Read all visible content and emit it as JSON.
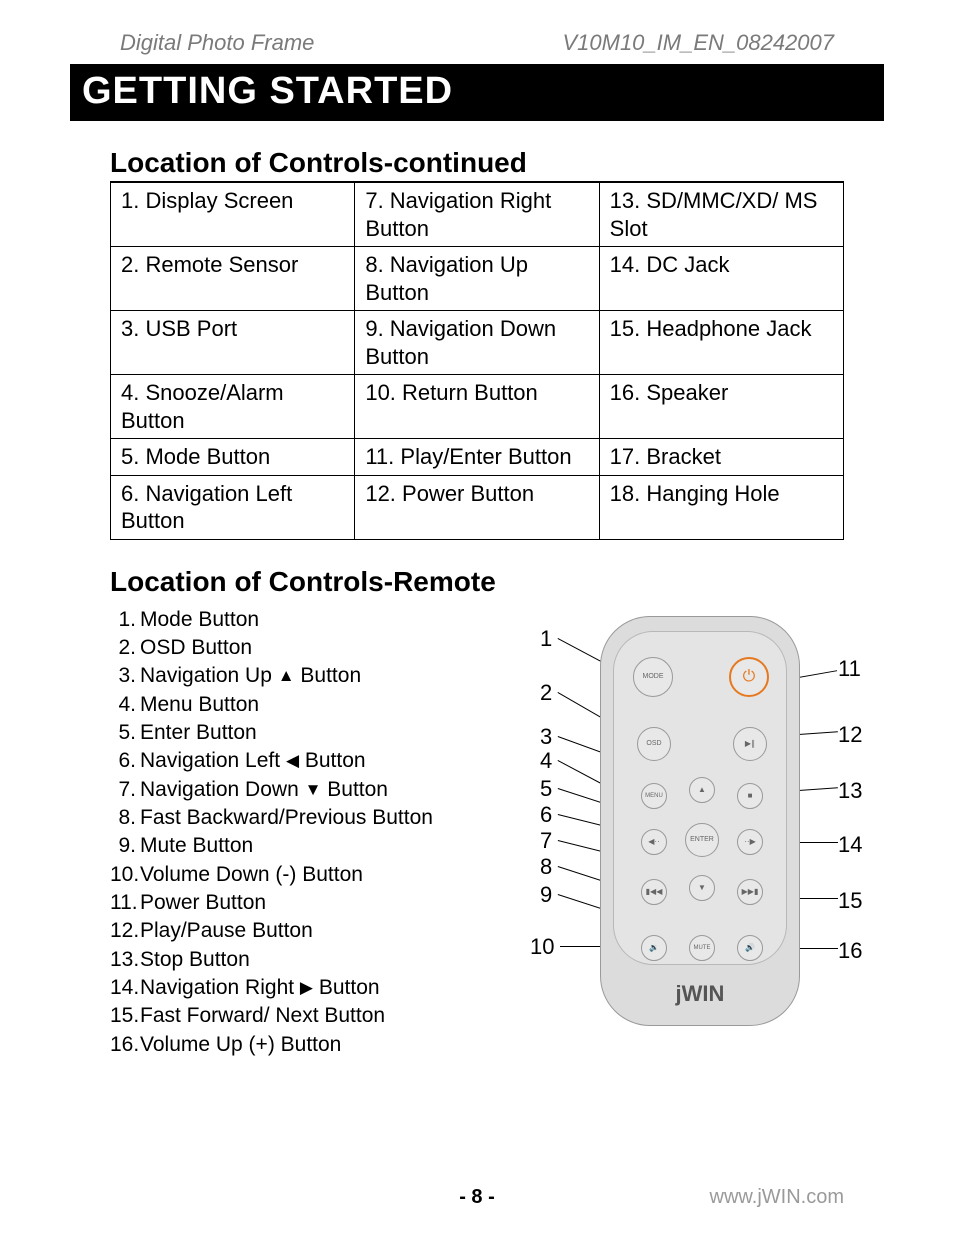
{
  "header": {
    "left": "Digital Photo Frame",
    "right": "V10M10_IM_EN_08242007"
  },
  "banner": "GETTING STARTED",
  "section1_title": "Location of Controls-continued",
  "controls_table": [
    [
      "1. Display Screen",
      "7. Navigation Right Button",
      "13. SD/MMC/XD/ MS Slot"
    ],
    [
      "2. Remote Sensor",
      "8. Navigation Up Button",
      "14. DC Jack"
    ],
    [
      "3. USB Port",
      "9. Navigation Down Button",
      "15. Headphone Jack"
    ],
    [
      "4. Snooze/Alarm Button",
      "10. Return Button",
      "16. Speaker"
    ],
    [
      "5. Mode Button",
      "11.  Play/Enter Button",
      "17. Bracket"
    ],
    [
      "6. Navigation Left Button",
      "12. Power Button",
      "18. Hanging Hole"
    ]
  ],
  "section2_title": "Location of Controls-Remote",
  "remote_items": [
    {
      "n": "1.",
      "t": "Mode Button"
    },
    {
      "n": "2.",
      "t": "OSD Button"
    },
    {
      "n": "3.",
      "t": "Navigation Up ",
      "g": "▲",
      "t2": " Button"
    },
    {
      "n": "4.",
      "t": "Menu Button"
    },
    {
      "n": "5.",
      "t": "Enter Button"
    },
    {
      "n": "6.",
      "t": "Navigation Left ",
      "g": "◀",
      "t2": " Button"
    },
    {
      "n": "7.",
      "t": "Navigation Down ",
      "g": "▼",
      "t2": " Button"
    },
    {
      "n": "8.",
      "t": "Fast Backward/Previous Button"
    },
    {
      "n": "9.",
      "t": "Mute Button"
    },
    {
      "n": "10.",
      "t": "Volume Down (-) Button"
    },
    {
      "n": "11.",
      "t": "Power Button"
    },
    {
      "n": "12.",
      "t": "Play/Pause Button"
    },
    {
      "n": "13.",
      "t": "Stop Button"
    },
    {
      "n": "14.",
      "t": "Navigation Right ",
      "g": "▶",
      "t2": " Button"
    },
    {
      "n": "15.",
      "t": "Fast Forward/ Next Button"
    },
    {
      "n": "16.",
      "t": "Volume Up (+) Button"
    }
  ],
  "remote_brand": "jWIN",
  "remote_btn_labels": {
    "mode": "MODE",
    "osd": "OSD",
    "menu": "MENU",
    "enter": "ENTER",
    "mute": "MUTE",
    "power": "⏻",
    "play": "▶∥",
    "stop": "■",
    "left": "◀··",
    "right": "··▶",
    "up": "▲",
    "down": "▼",
    "prev": "▮◀◀",
    "next": "▶▶▮",
    "volDn": "🔉",
    "volUp": "🔊"
  },
  "callouts_left": [
    {
      "n": "1"
    },
    {
      "n": "2"
    },
    {
      "n": "3"
    },
    {
      "n": "4"
    },
    {
      "n": "5"
    },
    {
      "n": "6"
    },
    {
      "n": "7"
    },
    {
      "n": "8"
    },
    {
      "n": "9"
    },
    {
      "n": "10"
    }
  ],
  "callouts_right": [
    {
      "n": "11"
    },
    {
      "n": "12"
    },
    {
      "n": "13"
    },
    {
      "n": "14"
    },
    {
      "n": "15"
    },
    {
      "n": "16"
    }
  ],
  "footer": {
    "page": "- 8 -",
    "url": "www.jWIN.com"
  }
}
